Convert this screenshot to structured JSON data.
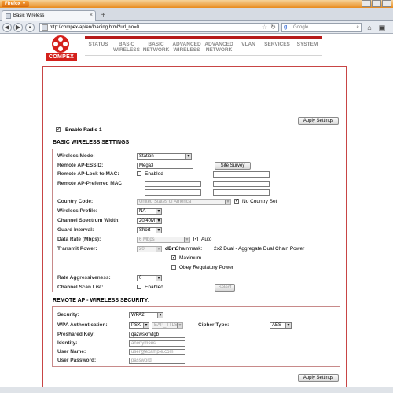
{
  "browser": {
    "app_button": "Firefox",
    "tab_title": "Basic Wireless",
    "url": "http://compex-ap/en/loading.html?url_no=0",
    "search_placeholder": "Google"
  },
  "logo": {
    "text": "COMPEX"
  },
  "nav": [
    {
      "line1": "STATUS",
      "line2": ""
    },
    {
      "line1": "BASIC",
      "line2": "WIRELESS"
    },
    {
      "line1": "BASIC",
      "line2": "NETWORK"
    },
    {
      "line1": "ADVANCED",
      "line2": "WIRELESS"
    },
    {
      "line1": "ADVANCED",
      "line2": "NETWORK"
    },
    {
      "line1": "VLAN",
      "line2": ""
    },
    {
      "line1": "SERVICES",
      "line2": ""
    },
    {
      "line1": "SYSTEM",
      "line2": ""
    }
  ],
  "page": {
    "apply_label": "Apply Settings",
    "enable_radio_label": "Enable Radio 1",
    "basic_title": "BASIC WIRELESS SETTINGS",
    "remote_title": "REMOTE AP - WIRELESS SECURITY:"
  },
  "basic": {
    "wireless_mode": {
      "label": "Wireless Mode:",
      "value": "Station"
    },
    "essid": {
      "label": "Remote AP-ESSID:",
      "value": "Mega3",
      "button": "Site Survey"
    },
    "lock_mac": {
      "label": "Remote AP-Lock to MAC:",
      "checkbox": "Enabled"
    },
    "preferred_mac": {
      "label": "Remote AP-Preferred MAC"
    },
    "country": {
      "label": "Country Code:",
      "value": "United States of America",
      "checkbox": "No Country Set"
    },
    "profile": {
      "label": "Wireless Profile:",
      "value": "NA"
    },
    "bandwidth": {
      "label": "Channel Spectrum Width:",
      "value": "20/40M"
    },
    "guard": {
      "label": "Guard Interval:",
      "value": "Short"
    },
    "data_rate": {
      "label": "Data Rate (Mbps):",
      "value": "6 Mbps",
      "checkbox": "Auto"
    },
    "tx_power": {
      "label": "Transmit Power:",
      "value": "20",
      "unit": "dBm",
      "chainmask_label": "Chainmask:",
      "chainmask_value": "2x2 Dual - Aggregate Dual Chain Power",
      "maximum": "Maximum",
      "obey": "Obey Regulatory Power"
    },
    "rate_aggr": {
      "label": "Rate Aggressiveness:",
      "value": "0"
    },
    "scan_list": {
      "label": "Channel Scan List:",
      "checkbox": "Enabled",
      "button": "Select"
    }
  },
  "security": {
    "security": {
      "label": "Security:",
      "value": "WPA2"
    },
    "wpa_auth": {
      "label": "WPA Authentication:",
      "value": "PSK",
      "eap": "EAP_TTLS"
    },
    "cipher": {
      "label": "Cipher Type:",
      "value": "AES"
    },
    "psk": {
      "label": "Preshared Key:",
      "value": "qazwsxrfvtgb"
    },
    "identity": {
      "label": "Identity:",
      "placeholder": "anonymous"
    },
    "username": {
      "label": "User Name:",
      "placeholder": "user@example.com"
    },
    "password": {
      "label": "User Password:",
      "placeholder": "password"
    }
  }
}
